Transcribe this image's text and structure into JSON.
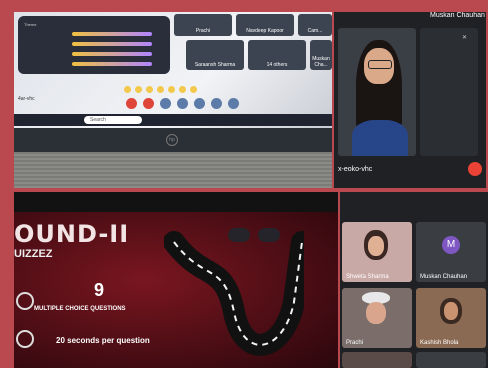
{
  "laptop_screen": {
    "tiles": [
      {
        "label": "Prachi"
      },
      {
        "label": "Navdeep Kapoor"
      },
      {
        "label": "Cam..."
      },
      {
        "label": "Saraansh Sharma"
      },
      {
        "label": "14 others"
      },
      {
        "label": "Muskan Cha..."
      }
    ],
    "meet_code": "4ar-vhc",
    "search_placeholder": "Search",
    "brand": "hp"
  },
  "meet_top": {
    "top_name": "Muskan Chauhan",
    "meet_code": "x-eoko-vhc"
  },
  "slide": {
    "title": "OUND-II",
    "subtitle": "UIZZEZ",
    "number": "9",
    "mcq_text": "MULTIPLE CHOICE QUESTIONS",
    "seconds_text": "20 seconds per question"
  },
  "meet_grid": {
    "tiles": [
      {
        "name": "Shweta Sharma"
      },
      {
        "name": "Muskan Chauhan",
        "avatar": "M"
      },
      {
        "name": "Prachi"
      },
      {
        "name": "Kashish Bhola"
      }
    ]
  },
  "colors": {
    "border": "#b9494e",
    "meet_bg": "#202124",
    "end_call": "#ea4335",
    "avatar": "#7e57c2"
  }
}
